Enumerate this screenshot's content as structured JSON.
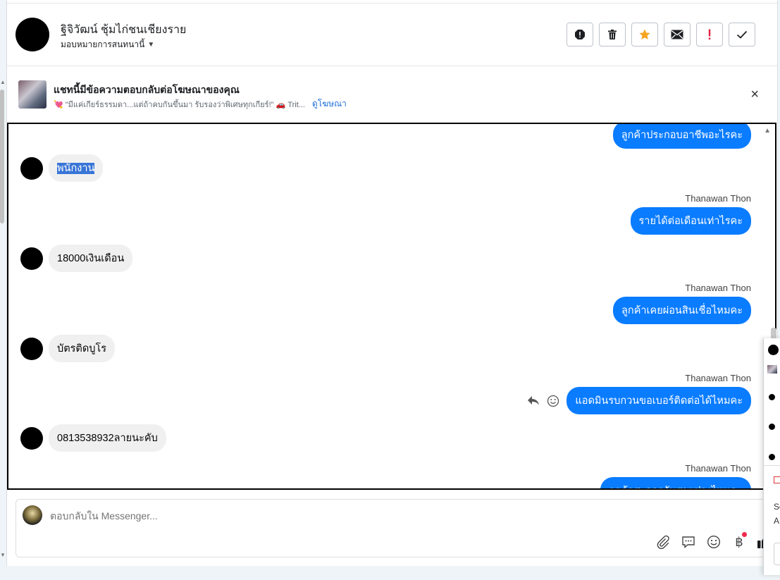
{
  "header": {
    "contact_name": "ฐิจิวัฒน์ ชุ้มไก่ชนเชียงราย",
    "assign_label": "มอบหมายการสนทนานี้",
    "actions": [
      "spam-icon",
      "trash-icon",
      "star-icon",
      "mail-icon",
      "follow-up-icon",
      "done-icon"
    ],
    "star_color": "#f5a623",
    "followup_color": "#e41e3f"
  },
  "ad_banner": {
    "title": "แชทนี้มีข้อความตอบกลับต่อโฆษณาของคุณ",
    "snippet": "💘 \"มีแค่เกียร์ธรรมดา...แต่ถ้าคบกันขึ้นมา รับรองว่าพิเศษทุกเกียร์!\" 🚗 Trit...",
    "link": "ดูโฆษณา",
    "close": "×"
  },
  "conversation": {
    "outgoing_sender": "Thanawan Thon",
    "messages": [
      {
        "dir": "out",
        "text": "ลูกค้าประกอบอาชีพอะไรคะ"
      },
      {
        "dir": "in",
        "text": "พนักงาน"
      },
      {
        "dir": "out",
        "sender": "Thanawan Thon",
        "text": "รายได้ต่อเดือนเท่าไรคะ"
      },
      {
        "dir": "in",
        "text": "18000เงินเดือน"
      },
      {
        "dir": "out",
        "sender": "Thanawan Thon",
        "text": "ลูกค้าเคยผ่อนสินเชื่อไหมคะ"
      },
      {
        "dir": "in",
        "text": "บัตรติดบูโร"
      },
      {
        "dir": "out",
        "sender": "Thanawan Thon",
        "text": "แอดมินรบกวนขอเบอร์ติดต่อได้ไหมคะ"
      },
      {
        "dir": "in",
        "text": "0813538932ลายนะคับ"
      },
      {
        "dir": "out",
        "sender": "Thanawan Thon",
        "text": "ลูกค้าสะดวกรับสายช่วงไหนคะ"
      }
    ],
    "brand_color": "#0a7cff"
  },
  "composer": {
    "placeholder": "ตอบกลับใน Messenger...",
    "tools": [
      "attach-icon",
      "saved-reply-icon",
      "emoji-icon",
      "baht-icon",
      "like-icon"
    ]
  },
  "side_popup": {
    "text1": "Se",
    "text2": "A"
  }
}
